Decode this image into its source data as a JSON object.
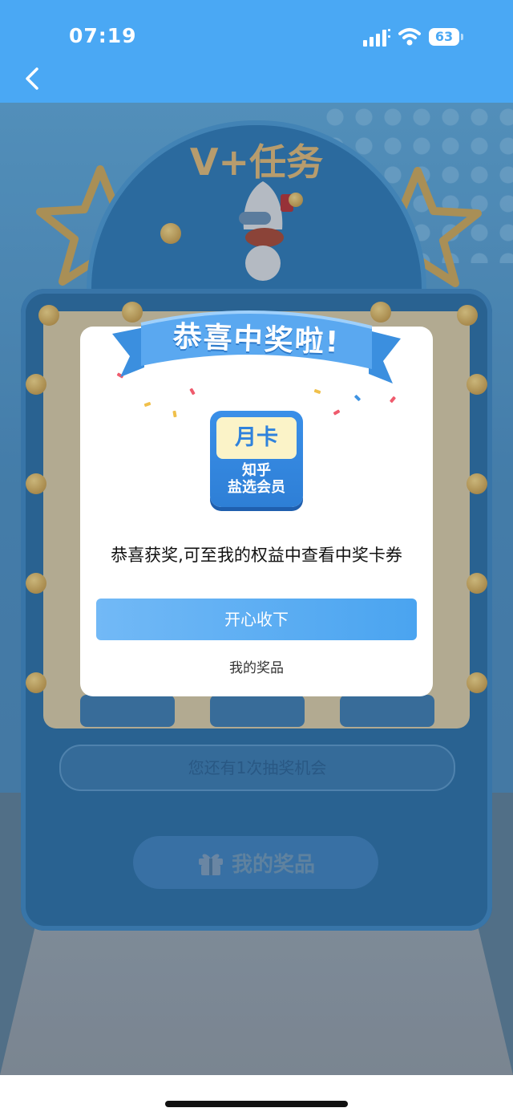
{
  "status_bar": {
    "time": "07:19",
    "battery": "63"
  },
  "nav": {
    "back_icon": "chevron-left-icon"
  },
  "background": {
    "title_art": "V+任务",
    "draw_chances_text": "您还有1次抽奖机会",
    "my_prizes_button": "我的奖品",
    "gift_icon": "gift-icon"
  },
  "modal": {
    "ribbon_title": "恭喜中奖啦!",
    "prize_card": {
      "badge": "月卡",
      "line1": "知乎",
      "line2": "盐选会员"
    },
    "message": "恭喜获奖,可至我的权益中查看中奖卡券",
    "accept_button": "开心收下",
    "my_prizes_link": "我的奖品"
  },
  "colors": {
    "header_blue": "#4aa8f4",
    "button_blue": "#4aa4f0",
    "ribbon_blue": "#4a9be8"
  }
}
